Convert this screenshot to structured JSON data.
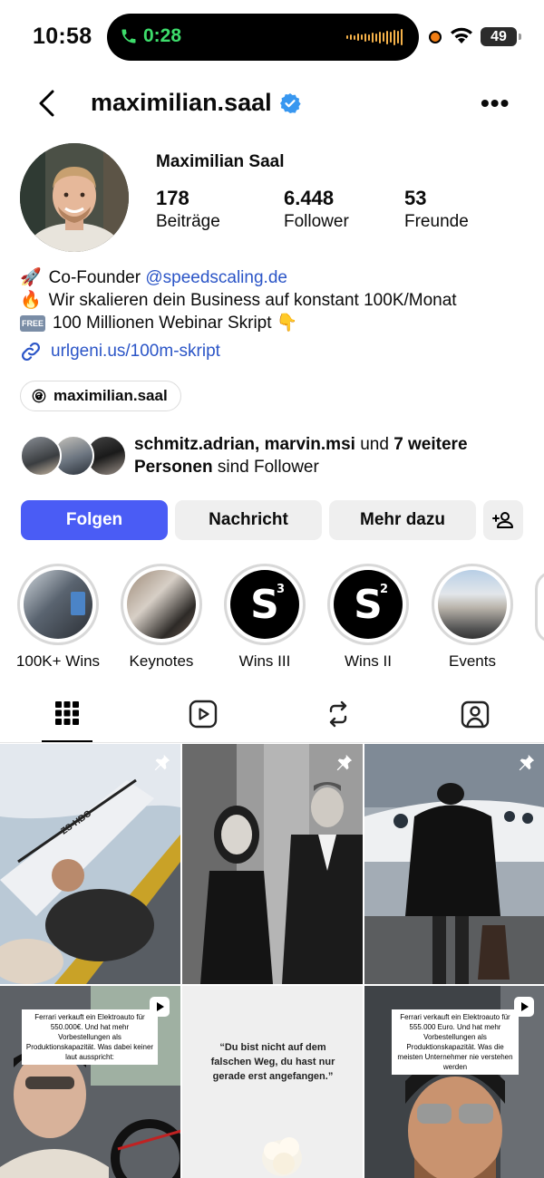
{
  "status": {
    "time": "10:58",
    "call_timer": "0:28",
    "battery": "49"
  },
  "header": {
    "username": "maximilian.saal",
    "more": "•••"
  },
  "profile": {
    "full_name": "Maximilian Saal",
    "stats": [
      {
        "value": "178",
        "label": "Beiträge"
      },
      {
        "value": "6.448",
        "label": "Follower"
      },
      {
        "value": "53",
        "label": "Freunde"
      }
    ],
    "bio": {
      "line1_emoji": "🚀",
      "line1_text": "Co-Founder ",
      "line1_link": "@speedscaling.de",
      "line2_emoji": "🔥",
      "line2_text": "Wir skalieren dein Business auf konstant 100K/Monat",
      "line3_badge": "FREE",
      "line3_text": "100 Millionen Webinar Skript 👇"
    },
    "url": "urlgeni.us/100m-skript",
    "threads_handle": "maximilian.saal",
    "followed_by": {
      "names": "schmitz.adrian, marvin.msi",
      "joiner": " und ",
      "more": "7 weitere Personen",
      "suffix": " sind Follower"
    }
  },
  "buttons": {
    "follow": "Folgen",
    "message": "Nachricht",
    "more": "Mehr dazu"
  },
  "highlights": [
    {
      "label": "100K+ Wins"
    },
    {
      "label": "Keynotes"
    },
    {
      "label": "Wins III",
      "logo": "S",
      "sup": "3"
    },
    {
      "label": "Wins II",
      "logo": "S",
      "sup": "2"
    },
    {
      "label": "Events"
    }
  ],
  "tabs": [
    "grid-icon",
    "reels-icon",
    "reposts-icon",
    "tagged-icon"
  ],
  "posts": [
    {
      "type": "pinned",
      "helicopter_reg": "ZS-HBO"
    },
    {
      "type": "pinned"
    },
    {
      "type": "pinned"
    },
    {
      "type": "reel",
      "caption": "Ferrari verkauft ein Elektroauto für 550.000€. Und hat mehr Vorbestellungen als Produktionskapazität. Was dabei keiner laut ausspricht:"
    },
    {
      "type": "image",
      "quote": "“Du bist nicht auf dem falschen Weg, du hast nur gerade erst angefangen.”"
    },
    {
      "type": "reel",
      "caption": "Ferrari verkauft ein Elektroauto für 555.000 Euro. Und hat mehr Vorbestellungen als Produktionskapazität. Was die meisten Unternehmer nie verstehen werden"
    }
  ]
}
